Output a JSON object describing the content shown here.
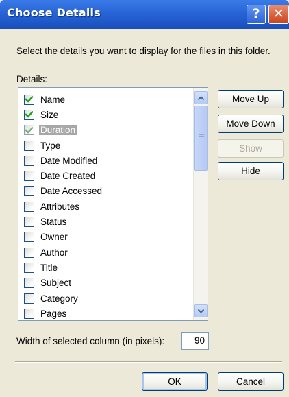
{
  "window": {
    "title": "Choose Details",
    "help_glyph": "?",
    "close_glyph": "✕",
    "icons": {
      "help": "help-icon",
      "close": "close-icon"
    }
  },
  "prompt": "Select the details you want to display for the files in this folder.",
  "details_label": "Details:",
  "details": [
    {
      "label": "Name",
      "checked": true,
      "selected": false
    },
    {
      "label": "Size",
      "checked": true,
      "selected": false
    },
    {
      "label": "Duration",
      "checked": true,
      "selected": true
    },
    {
      "label": "Type",
      "checked": false,
      "selected": false
    },
    {
      "label": "Date Modified",
      "checked": false,
      "selected": false
    },
    {
      "label": "Date Created",
      "checked": false,
      "selected": false
    },
    {
      "label": "Date Accessed",
      "checked": false,
      "selected": false
    },
    {
      "label": "Attributes",
      "checked": false,
      "selected": false
    },
    {
      "label": "Status",
      "checked": false,
      "selected": false
    },
    {
      "label": "Owner",
      "checked": false,
      "selected": false
    },
    {
      "label": "Author",
      "checked": false,
      "selected": false
    },
    {
      "label": "Title",
      "checked": false,
      "selected": false
    },
    {
      "label": "Subject",
      "checked": false,
      "selected": false
    },
    {
      "label": "Category",
      "checked": false,
      "selected": false
    },
    {
      "label": "Pages",
      "checked": false,
      "selected": false
    },
    {
      "label": "",
      "checked": false,
      "selected": false
    }
  ],
  "buttons": {
    "move_up": "Move Up",
    "move_down": "Move Down",
    "show": "Show",
    "hide": "Hide",
    "ok": "OK",
    "cancel": "Cancel"
  },
  "width": {
    "label": "Width of selected column (in pixels):",
    "value": "90"
  },
  "colors": {
    "titlebar": "#2a66d8",
    "check": "#21a121",
    "check_dim": "#7fae7f",
    "selection": "#a7a7a7"
  }
}
